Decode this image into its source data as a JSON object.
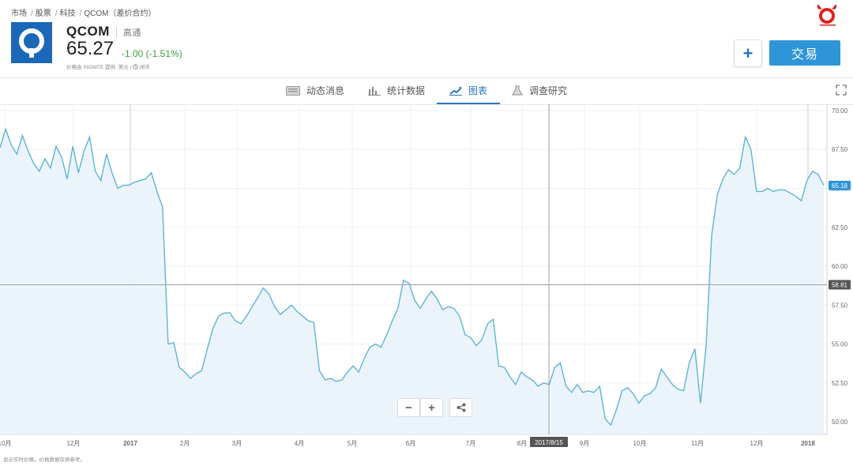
{
  "breadcrumb": [
    "市场",
    "股票",
    "科技",
    "QCOM（差价合约）"
  ],
  "instrument": {
    "ticker": "QCOM",
    "name": "高通",
    "price": "65.27",
    "change": "-1.00 (-1.51%)",
    "source": "价格由 XIGNITE 提供. 美元 | ",
    "source_status": "闭市"
  },
  "actions": {
    "add_label": "+",
    "trade_label": "交易"
  },
  "tabs": [
    {
      "label": "动态消息",
      "icon": "news-icon",
      "active": false
    },
    {
      "label": "统计数据",
      "icon": "stats-icon",
      "active": false
    },
    {
      "label": "图表",
      "icon": "chart-icon",
      "active": true
    },
    {
      "label": "调查研究",
      "icon": "research-icon",
      "active": false
    }
  ],
  "zoom": {
    "minus": "−",
    "plus": "+"
  },
  "footer": "显示实时价格。价格数据仅供参考。",
  "colors": {
    "accent": "#2e95d8",
    "positive": "#3aa047",
    "line": "#5fb3d9"
  },
  "chart_data": {
    "type": "area",
    "x_labels": [
      "10月",
      "12月",
      "2017",
      "2月",
      "3月",
      "4月",
      "5月",
      "6月",
      "7月",
      "8月",
      "9月",
      "10月",
      "11月",
      "12月",
      "2018"
    ],
    "y_ticks": [
      "70.00",
      "67.50",
      "65.00",
      "62.50",
      "60.00",
      "57.50",
      "55.00",
      "52.50",
      "50.00"
    ],
    "ylim": [
      49.2,
      70.4
    ],
    "current_price_label": "65.18",
    "crosshair_price_label": "58.81",
    "crosshair_date_label": "2017/8/15",
    "values": [
      67.6,
      68.8,
      67.8,
      67.2,
      68.4,
      67.4,
      66.6,
      66.1,
      66.9,
      66.3,
      67.7,
      67.0,
      65.6,
      67.7,
      66.0,
      67.4,
      68.3,
      66.1,
      65.5,
      67.2,
      66.0,
      65.0,
      65.2,
      65.2,
      65.4,
      65.5,
      65.6,
      66.0,
      64.8,
      63.8,
      55.0,
      55.1,
      53.5,
      53.2,
      52.8,
      53.1,
      53.3,
      54.7,
      56.0,
      56.8,
      57.0,
      57.0,
      56.5,
      56.3,
      56.8,
      57.4,
      58.0,
      58.6,
      58.2,
      57.4,
      56.9,
      57.2,
      57.5,
      57.1,
      56.8,
      56.5,
      56.4,
      53.3,
      52.7,
      52.8,
      52.6,
      52.7,
      53.2,
      53.6,
      53.2,
      54.1,
      54.8,
      55.0,
      54.8,
      55.6,
      56.5,
      57.3,
      59.1,
      58.9,
      57.8,
      57.3,
      57.9,
      58.4,
      57.9,
      57.2,
      57.4,
      57.3,
      56.8,
      55.6,
      55.4,
      54.9,
      55.3,
      56.3,
      56.6,
      53.6,
      53.5,
      52.9,
      52.4,
      53.2,
      52.9,
      52.7,
      52.3,
      52.5,
      52.4,
      53.5,
      53.8,
      52.3,
      51.9,
      52.4,
      51.9,
      52.0,
      51.9,
      52.3,
      50.2,
      49.8,
      50.8,
      52.0,
      52.2,
      51.8,
      51.2,
      51.7,
      51.8,
      52.2,
      53.4,
      52.9,
      52.4,
      52.1,
      52.0,
      53.8,
      54.7,
      51.2,
      54.9,
      62.0,
      64.6,
      65.6,
      66.2,
      65.9,
      66.3,
      68.3,
      67.5,
      64.8,
      64.8,
      65.0,
      64.8,
      64.9,
      64.9,
      64.7,
      64.5,
      64.2,
      65.5,
      66.1,
      65.9,
      65.2
    ]
  }
}
